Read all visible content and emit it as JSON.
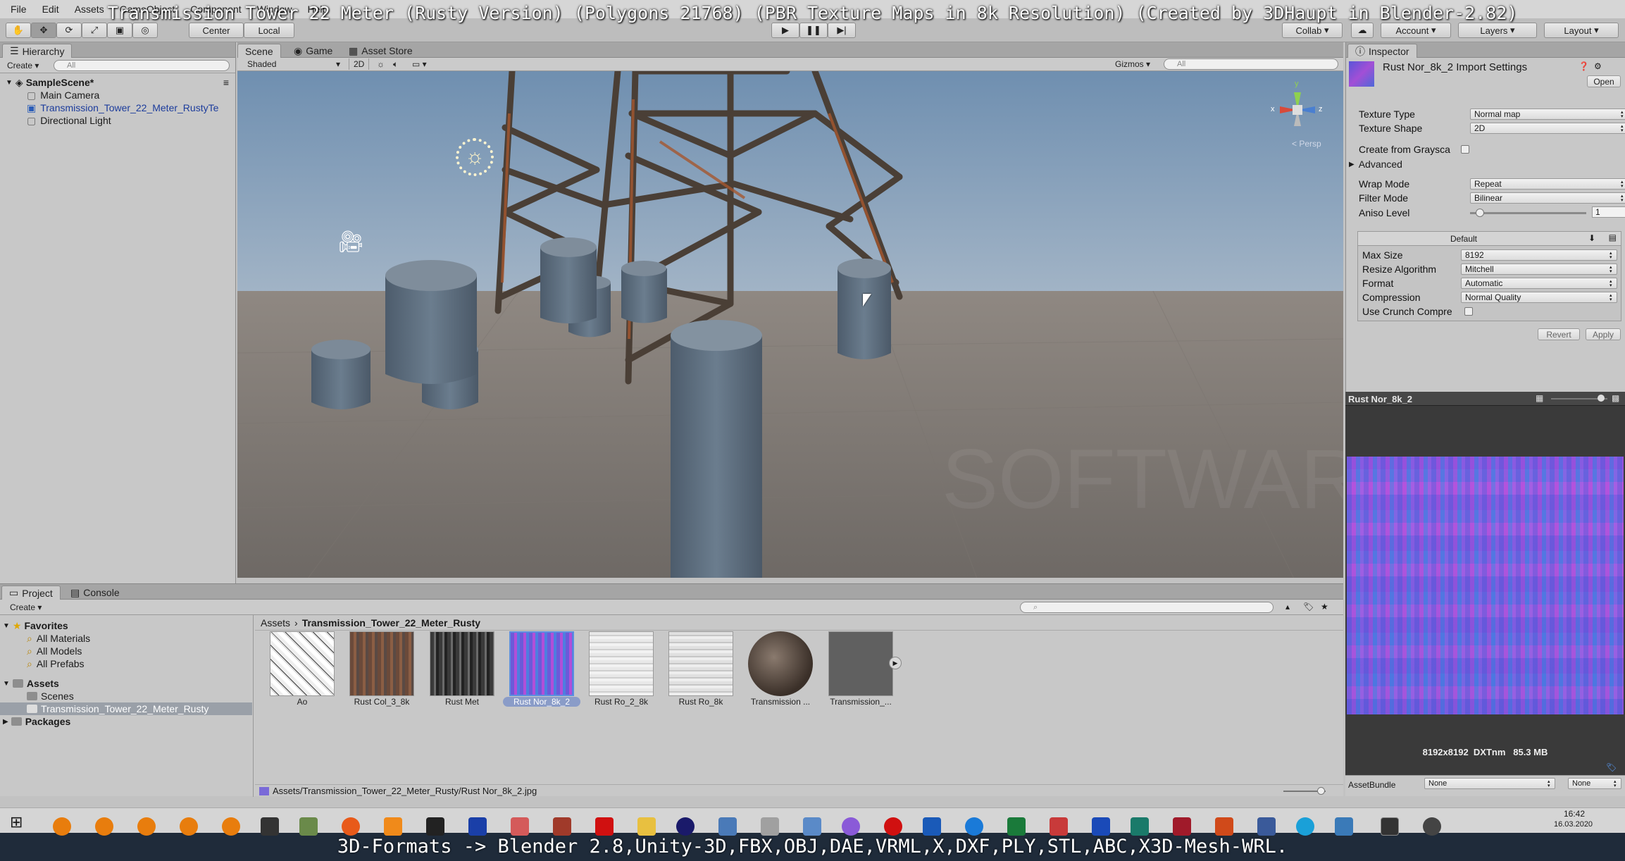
{
  "video_title": "Transmission Tower 22 Meter (Rusty Version) (Polygons 21768) (PBR Texture Maps in 8k Resolution) (Created by 3DHaupt in Blender-2.82)",
  "bottom_caption": "3D-Formats -> Blender 2.8,Unity-3D,FBX,OBJ,DAE,VRML,X,DXF,PLY,STL,ABC,X3D-Mesh-WRL.",
  "menu": [
    "File",
    "Edit",
    "Assets",
    "GameObject",
    "Component",
    "Window",
    "Help"
  ],
  "toolbar": {
    "pivot_center": "Center",
    "pivot_local": "Local",
    "collab": "Collab",
    "account": "Account",
    "layers": "Layers",
    "layout": "Layout"
  },
  "hierarchy": {
    "tab": "Hierarchy",
    "create": "Create",
    "search_placeholder": "All",
    "scene": "SampleScene*",
    "items": [
      "Main Camera",
      "Transmission_Tower_22_Meter_RustyTe",
      "Directional Light"
    ]
  },
  "scene": {
    "tabs": [
      "Scene",
      "Game",
      "Asset Store"
    ],
    "shading": "Shaded",
    "mode_2d": "2D",
    "gizmos": "Gizmos",
    "search_placeholder": "All",
    "persp": "Persp",
    "axis_y": "y",
    "axis_x": "x",
    "axis_z": "z",
    "watermark": "SOFTWARE SERVICE JOHN"
  },
  "inspector": {
    "tab": "Inspector",
    "title": "Rust Nor_8k_2 Import Settings",
    "open": "Open",
    "texture_type_label": "Texture Type",
    "texture_type": "Normal map",
    "texture_shape_label": "Texture Shape",
    "texture_shape": "2D",
    "create_from_grayscale": "Create from Graysca",
    "advanced": "Advanced",
    "wrap_mode_label": "Wrap Mode",
    "wrap_mode": "Repeat",
    "filter_mode_label": "Filter Mode",
    "filter_mode": "Bilinear",
    "aniso_label": "Aniso Level",
    "aniso_value": "1",
    "aniso_fraction": 0.05,
    "platform": "Default",
    "max_size_label": "Max Size",
    "max_size": "8192",
    "resize_label": "Resize Algorithm",
    "resize": "Mitchell",
    "format_label": "Format",
    "format": "Automatic",
    "compression_label": "Compression",
    "compression": "Normal Quality",
    "crunch": "Use Crunch Compre",
    "revert": "Revert",
    "apply": "Apply"
  },
  "preview": {
    "title": "Rust Nor_8k_2",
    "info": "8192x8192  DXTnm   85.3 MB",
    "assetbundle_label": "AssetBundle",
    "assetbundle": "None",
    "variant": "None"
  },
  "project": {
    "tabs": [
      "Project",
      "Console"
    ],
    "create": "Create",
    "favorites": "Favorites",
    "fav_items": [
      "All Materials",
      "All Models",
      "All Prefabs"
    ],
    "assets": "Assets",
    "asset_folders": [
      "Scenes",
      "Transmission_Tower_22_Meter_Rusty"
    ],
    "packages": "Packages",
    "breadcrumb_root": "Assets",
    "breadcrumb_current": "Transmission_Tower_22_Meter_Rusty",
    "thumbnails": [
      "Ao",
      "Rust Col_3_8k",
      "Rust Met",
      "Rust Nor_8k_2",
      "Rust Ro_2_8k",
      "Rust Ro_8k",
      "Transmission ...",
      "Transmission_..."
    ],
    "status_path": "Assets/Transmission_Tower_22_Meter_Rusty/Rust Nor_8k_2.jpg"
  },
  "taskbar": {
    "time": "16:42",
    "date": "16.03.2020"
  }
}
